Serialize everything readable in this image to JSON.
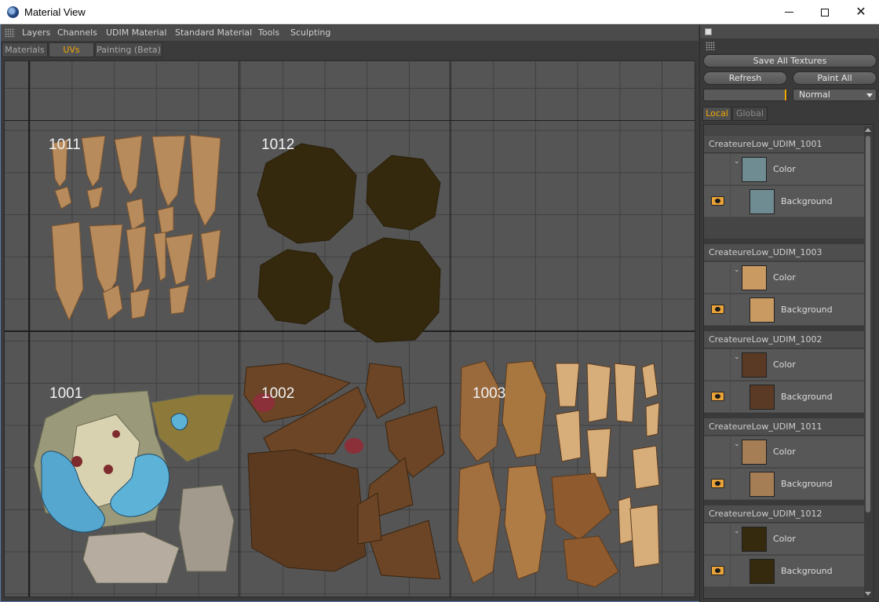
{
  "window": {
    "title": "Material View"
  },
  "menu": [
    "Layers",
    "Channels",
    "UDIM Material",
    "Standard Material",
    "Tools",
    "Sculpting"
  ],
  "tabs": [
    {
      "label": "Materials",
      "active": false
    },
    {
      "label": "UVs",
      "active": true
    },
    {
      "label": "Painting (Beta)",
      "active": false
    }
  ],
  "viewport": {
    "tiles": [
      "1011",
      "1012",
      "1001",
      "1002",
      "1003"
    ]
  },
  "right_panel": {
    "save_all_label": "Save All Textures",
    "refresh_label": "Refresh",
    "paint_all_label": "Paint All",
    "blend_mode": "Normal",
    "tabs": [
      {
        "label": "Local",
        "active": true
      },
      {
        "label": "Global",
        "active": false
      }
    ],
    "materials": [
      {
        "name": "CreateureLow_UDIM_1001",
        "channel": "Color",
        "layer": "Background",
        "thumb_color": "#6f8c93"
      },
      {
        "name": "CreateureLow_UDIM_1003",
        "channel": "Color",
        "layer": "Background",
        "thumb_color": "#c99a62"
      },
      {
        "name": "CreateureLow_UDIM_1002",
        "channel": "Color",
        "layer": "Background",
        "thumb_color": "#5a3a24"
      },
      {
        "name": "CreateureLow_UDIM_1011",
        "channel": "Color",
        "layer": "Background",
        "thumb_color": "#a57e55"
      },
      {
        "name": "CreateureLow_UDIM_1012",
        "channel": "Color",
        "layer": "Background",
        "thumb_color": "#35290e"
      }
    ]
  },
  "colors": {
    "accent": "#f0a800",
    "panel": "#3a3a3a",
    "grid_bg": "#555555"
  }
}
